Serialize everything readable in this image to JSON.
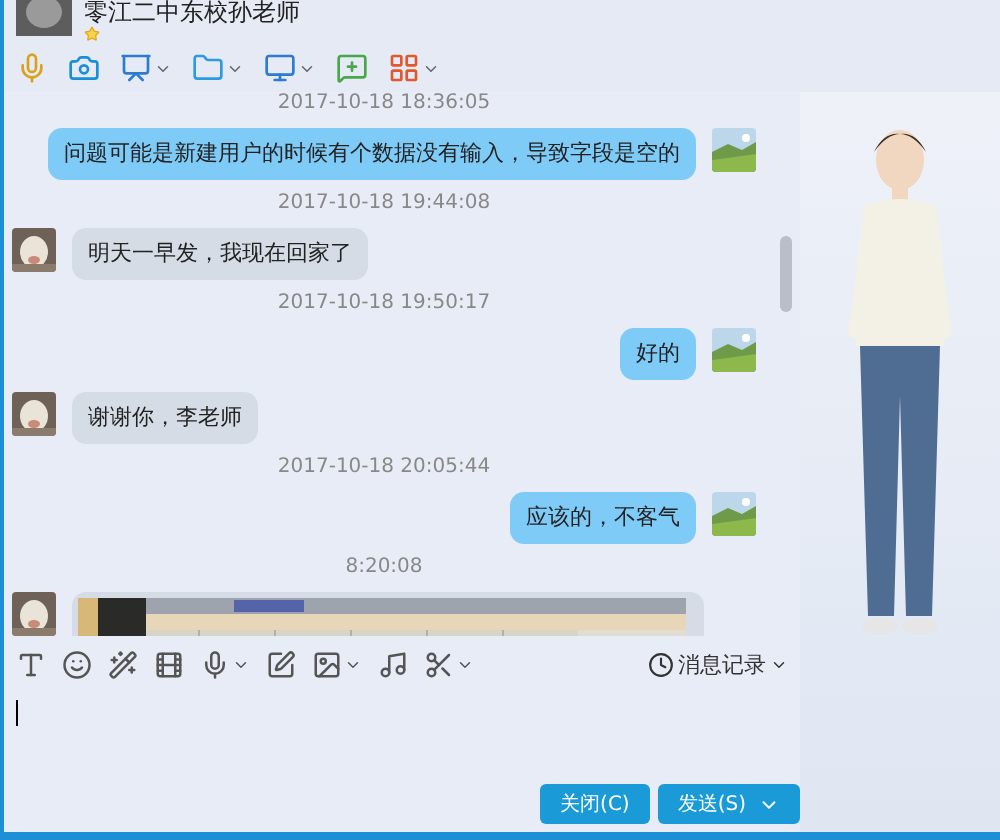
{
  "contact": {
    "name": "零江二中东校孙老师",
    "starred": true
  },
  "messages": [
    {
      "kind": "timestamp",
      "text": "2017-10-18 18:36:05"
    },
    {
      "kind": "text",
      "outgoing": true,
      "text": "问题可能是新建用户的时候有个数据没有输入，导致字段是空的"
    },
    {
      "kind": "timestamp",
      "text": "2017-10-18 19:44:08"
    },
    {
      "kind": "text",
      "outgoing": false,
      "text": "明天一早发，我现在回家了"
    },
    {
      "kind": "timestamp",
      "text": "2017-10-18 19:50:17"
    },
    {
      "kind": "text",
      "outgoing": true,
      "text": "好的"
    },
    {
      "kind": "text",
      "outgoing": false,
      "text": "谢谢你，李老师"
    },
    {
      "kind": "timestamp",
      "text": "2017-10-18 20:05:44"
    },
    {
      "kind": "text",
      "outgoing": true,
      "text": "应该的，不客气"
    },
    {
      "kind": "timestamp",
      "text": "8:20:08"
    },
    {
      "kind": "picture",
      "outgoing": false
    }
  ],
  "history_button": "消息记录",
  "buttons": {
    "close": "关闭(C)",
    "send": "发送(S)"
  }
}
